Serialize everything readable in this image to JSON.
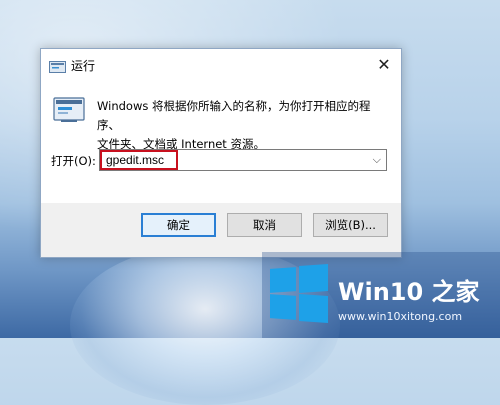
{
  "window": {
    "title": "运行",
    "close_glyph": "✕"
  },
  "dialog": {
    "description_line1": "Windows 将根据你所输入的名称，为你打开相应的程序、",
    "description_line2": "文件夹、文档或 Internet 资源。",
    "open_label": "打开(O):",
    "input_value": "gpedit.msc",
    "dropdown_glyph": "⌵",
    "highlight_color": "#c8101e"
  },
  "buttons": {
    "ok": "确定",
    "cancel": "取消",
    "browse": "浏览(B)..."
  },
  "watermark": {
    "brand": "Win10 之家",
    "url": "www.win10xitong.com"
  }
}
